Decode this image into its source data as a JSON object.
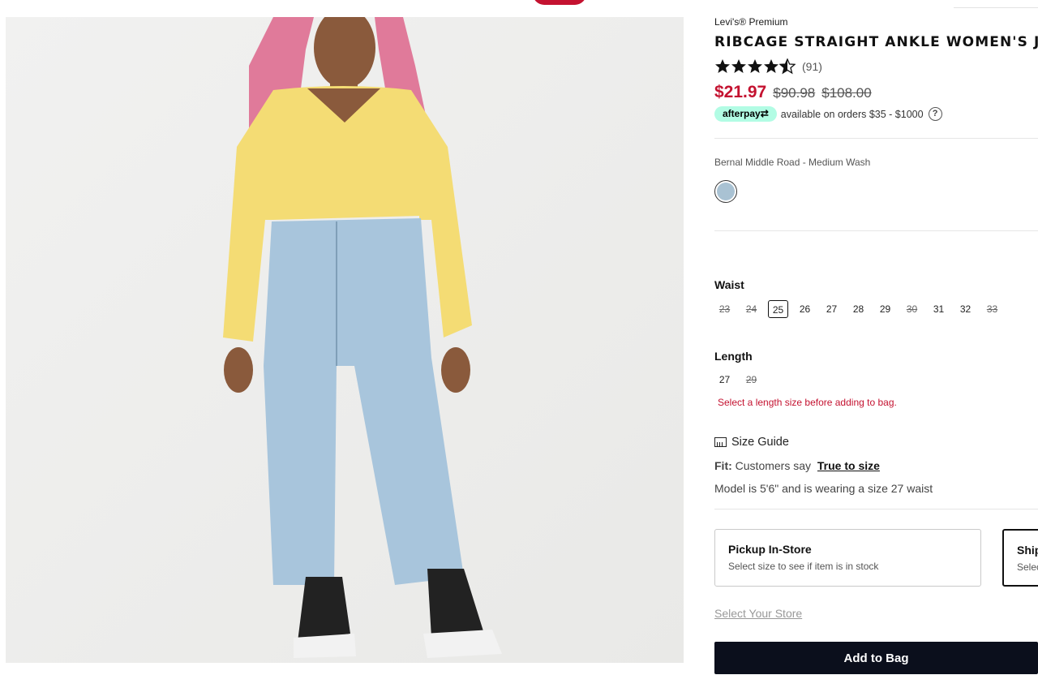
{
  "product": {
    "brand": "Levi's® Premium",
    "title": "RIBCAGE STRAIGHT ANKLE WOMEN'S JEANS",
    "rating_stars": 4.5,
    "rating_count": "(91)",
    "price_sale": "$21.97",
    "price_was_1": "$90.98",
    "price_was_2": "$108.00"
  },
  "afterpay": {
    "badge": "afterpay⇄",
    "text": "available on orders $35 - $1000",
    "help": "?"
  },
  "color": {
    "name": "Bernal Middle Road - Medium Wash",
    "swatch_hex": "#a9c2d3"
  },
  "waist": {
    "label": "Waist",
    "sizes": [
      {
        "label": "23",
        "available": false
      },
      {
        "label": "24",
        "available": false
      },
      {
        "label": "25",
        "available": true,
        "selected": true
      },
      {
        "label": "26",
        "available": true
      },
      {
        "label": "27",
        "available": true
      },
      {
        "label": "28",
        "available": true
      },
      {
        "label": "29",
        "available": true
      },
      {
        "label": "30",
        "available": false
      },
      {
        "label": "31",
        "available": true
      },
      {
        "label": "32",
        "available": true
      },
      {
        "label": "33",
        "available": false
      }
    ]
  },
  "length": {
    "label": "Length",
    "sizes": [
      {
        "label": "27",
        "available": true
      },
      {
        "label": "29",
        "available": false
      }
    ],
    "error": "Select a length size before adding to bag."
  },
  "size_guide": {
    "label": "Size Guide"
  },
  "fit": {
    "label": "Fit:",
    "text": "Customers say",
    "link": "True to size"
  },
  "model_note": "Model is 5'6\" and is wearing a size 27 waist",
  "pickup": {
    "title": "Pickup In-Store",
    "subtitle": "Select size to see if item is in stock"
  },
  "ship": {
    "title": "Ship",
    "subtitle": "Selec"
  },
  "select_store": "Select Your Store",
  "add_to_bag": "Add to Bag",
  "colors": {
    "sale_red": "#c41230",
    "afterpay_mint": "#b2fce4",
    "button_dark": "#0b0f1c"
  }
}
